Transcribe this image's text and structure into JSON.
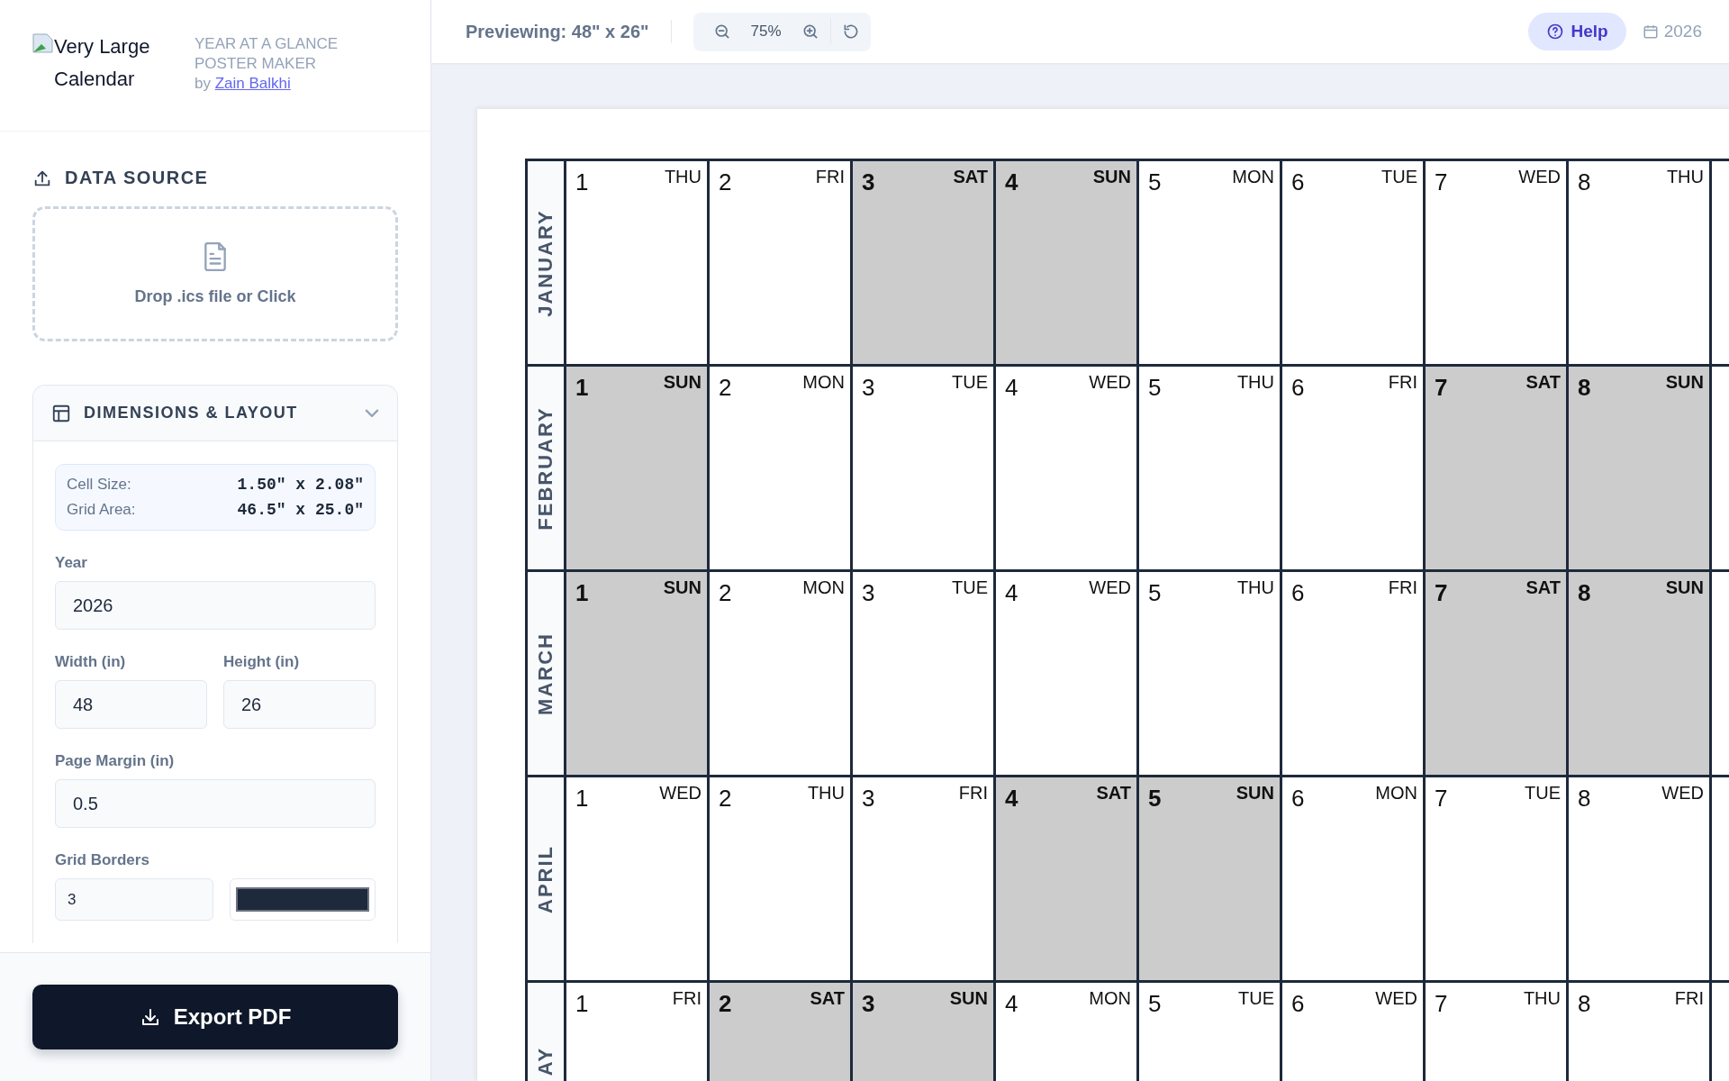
{
  "brand": {
    "logo_alt": "Very Large Calendar",
    "tagline": "YEAR AT A GLANCE POSTER MAKER",
    "byline": "by",
    "author": "Zain Balkhi"
  },
  "data_source": {
    "title": "DATA SOURCE",
    "dropzone": "Drop .ics file or Click"
  },
  "dimensions": {
    "title": "DIMENSIONS & LAYOUT",
    "expanded": true,
    "info": [
      {
        "label": "Cell Size:",
        "value": "1.50\" x 2.08\""
      },
      {
        "label": "Grid Area:",
        "value": "46.5\" x 25.0\""
      }
    ],
    "year": {
      "label": "Year",
      "value": "2026"
    },
    "width": {
      "label": "Width (in)",
      "value": "48"
    },
    "height": {
      "label": "Height (in)",
      "value": "26"
    },
    "margin": {
      "label": "Page Margin (in)",
      "value": "0.5"
    },
    "grid_borders": {
      "label": "Grid Borders",
      "value": "3",
      "color": "#1e293b"
    }
  },
  "export_button": "Export PDF",
  "toolbar": {
    "preview": "Previewing: 48\" x 26\"",
    "zoom": "75%",
    "help": "Help",
    "year": "2026"
  },
  "calendar": {
    "months": [
      {
        "name": "JANUARY",
        "days": [
          {
            "day": "1",
            "weekday": "THU",
            "weekend": false
          },
          {
            "day": "2",
            "weekday": "FRI",
            "weekend": false
          },
          {
            "day": "3",
            "weekday": "SAT",
            "weekend": true
          },
          {
            "day": "4",
            "weekday": "SUN",
            "weekend": true
          },
          {
            "day": "5",
            "weekday": "MON",
            "weekend": false
          },
          {
            "day": "6",
            "weekday": "TUE",
            "weekend": false
          },
          {
            "day": "7",
            "weekday": "WED",
            "weekend": false
          },
          {
            "day": "8",
            "weekday": "THU",
            "weekend": false
          }
        ]
      },
      {
        "name": "FEBRUARY",
        "days": [
          {
            "day": "1",
            "weekday": "SUN",
            "weekend": true
          },
          {
            "day": "2",
            "weekday": "MON",
            "weekend": false
          },
          {
            "day": "3",
            "weekday": "TUE",
            "weekend": false
          },
          {
            "day": "4",
            "weekday": "WED",
            "weekend": false
          },
          {
            "day": "5",
            "weekday": "THU",
            "weekend": false
          },
          {
            "day": "6",
            "weekday": "FRI",
            "weekend": false
          },
          {
            "day": "7",
            "weekday": "SAT",
            "weekend": true
          },
          {
            "day": "8",
            "weekday": "SUN",
            "weekend": true
          }
        ]
      },
      {
        "name": "MARCH",
        "days": [
          {
            "day": "1",
            "weekday": "SUN",
            "weekend": true
          },
          {
            "day": "2",
            "weekday": "MON",
            "weekend": false
          },
          {
            "day": "3",
            "weekday": "TUE",
            "weekend": false
          },
          {
            "day": "4",
            "weekday": "WED",
            "weekend": false
          },
          {
            "day": "5",
            "weekday": "THU",
            "weekend": false
          },
          {
            "day": "6",
            "weekday": "FRI",
            "weekend": false
          },
          {
            "day": "7",
            "weekday": "SAT",
            "weekend": true
          },
          {
            "day": "8",
            "weekday": "SUN",
            "weekend": true
          }
        ]
      },
      {
        "name": "APRIL",
        "days": [
          {
            "day": "1",
            "weekday": "WED",
            "weekend": false
          },
          {
            "day": "2",
            "weekday": "THU",
            "weekend": false
          },
          {
            "day": "3",
            "weekday": "FRI",
            "weekend": false
          },
          {
            "day": "4",
            "weekday": "SAT",
            "weekend": true
          },
          {
            "day": "5",
            "weekday": "SUN",
            "weekend": true
          },
          {
            "day": "6",
            "weekday": "MON",
            "weekend": false
          },
          {
            "day": "7",
            "weekday": "TUE",
            "weekend": false
          },
          {
            "day": "8",
            "weekday": "WED",
            "weekend": false
          }
        ]
      },
      {
        "name": "AY",
        "days": [
          {
            "day": "1",
            "weekday": "FRI",
            "weekend": false
          },
          {
            "day": "2",
            "weekday": "SAT",
            "weekend": true
          },
          {
            "day": "3",
            "weekday": "SUN",
            "weekend": true
          },
          {
            "day": "4",
            "weekday": "MON",
            "weekend": false
          },
          {
            "day": "5",
            "weekday": "TUE",
            "weekend": false
          },
          {
            "day": "6",
            "weekday": "WED",
            "weekend": false
          },
          {
            "day": "7",
            "weekday": "THU",
            "weekend": false
          },
          {
            "day": "8",
            "weekday": "FRI",
            "weekend": false
          }
        ]
      }
    ]
  }
}
